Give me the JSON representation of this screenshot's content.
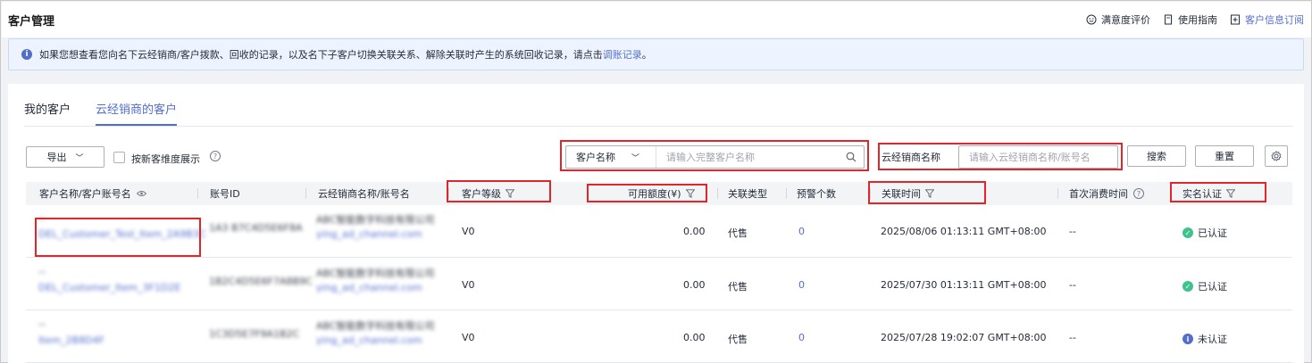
{
  "header": {
    "title": "客户管理",
    "links": [
      {
        "label": "满意度评价",
        "icon": "smile-icon"
      },
      {
        "label": "使用指南",
        "icon": "document-icon"
      },
      {
        "label": "客户信息订阅",
        "icon": "subscribe-icon"
      }
    ]
  },
  "notice": {
    "text": "如果您想查看您向名下云经销商/客户拨款、回收的记录，以及名下子客户切换关联关系、解除关联时产生的系统回收记录，请点击",
    "link": "调账记录",
    "suffix": "。"
  },
  "tabs": [
    {
      "label": "我的客户",
      "active": false
    },
    {
      "label": "云经销商的客户",
      "active": true
    }
  ],
  "toolbar": {
    "export_label": "导出",
    "checkbox_label": "按新客维度展示",
    "search_type": "客户名称",
    "search_placeholder": "请输入完整客户名称",
    "reseller_label": "云经销商名称",
    "reseller_placeholder": "请输入云经销商名称/账号名",
    "search_button": "搜索",
    "reset_button": "重置"
  },
  "table": {
    "columns": [
      "客户名称/客户账号名",
      "账号ID",
      "云经销商名称/账号名",
      "客户等级",
      "可用额度(¥)",
      "关联类型",
      "预警个数",
      "关联时间",
      "首次消费时间",
      "实名认证"
    ],
    "rows": [
      {
        "name_top": "--",
        "name": "DEL_Customer_Test_Item_2A9B3C",
        "account_id": "1A3 B7C4D5E6F8A",
        "reseller_top": "ABC智能数字科技有限公司",
        "reseller": "ying_ad_channel.com",
        "level": "V0",
        "credit": "0.00",
        "relation": "代售",
        "alerts": "0",
        "time": "2025/08/06 01:13:11 GMT+08:00",
        "first_spend": "--",
        "auth": "已认证",
        "auth_ok": true
      },
      {
        "name_top": "--",
        "name": "DEL_Customer_Item_3F1D2E",
        "account_id": "1B2C4D5E6F7A8B9C",
        "reseller_top": "ABC智能数字科技有限公司",
        "reseller": "ying_ad_channel.com",
        "level": "V0",
        "credit": "0.00",
        "relation": "代售",
        "alerts": "0",
        "time": "2025/07/30 01:13:11 GMT+08:00",
        "first_spend": "--",
        "auth": "已认证",
        "auth_ok": true
      },
      {
        "name_top": "--",
        "name": "Item_2B8D4F",
        "account_id": "1C3D5E7F9A1B2C",
        "reseller_top": "ABC智能数字科技有限公司",
        "reseller": "ying_ad_channel.com",
        "level": "V0",
        "credit": "0.00",
        "relation": "代售",
        "alerts": "0",
        "time": "2025/07/28 19:02:07 GMT+08:00",
        "first_spend": "--",
        "auth": "未认证",
        "auth_ok": false
      }
    ]
  },
  "colors": {
    "accent": "#526ecc",
    "highlight": "#e0262b",
    "success": "#3ec28e"
  }
}
